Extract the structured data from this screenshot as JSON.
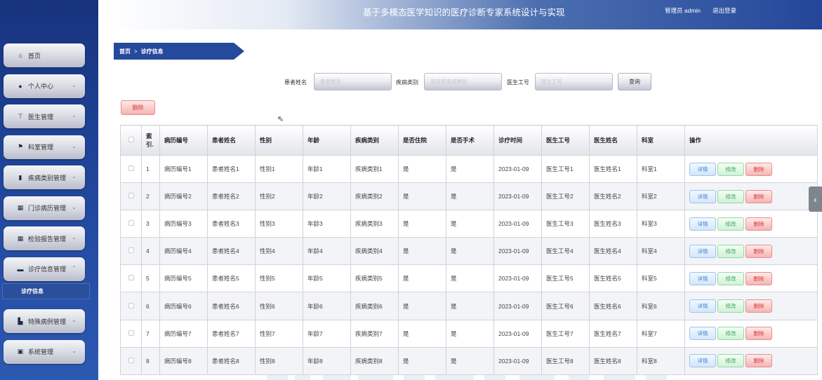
{
  "header": {
    "title": "基于多模态医学知识的医疗诊断专家系统设计与实现",
    "admin": "管理员 admin",
    "logout": "退出登录"
  },
  "sidebar": {
    "items": [
      {
        "label": "首页",
        "icon": "home-icon",
        "glyph": "⌂",
        "chevron": ""
      },
      {
        "label": "个人中心",
        "icon": "user-icon",
        "glyph": "●",
        "chevron": "⌄"
      },
      {
        "label": "医生管理",
        "icon": "doctor-icon",
        "glyph": "⊤",
        "chevron": "⌄"
      },
      {
        "label": "科室管理",
        "icon": "flag-icon",
        "glyph": "⚑",
        "chevron": "⌄"
      },
      {
        "label": "疾病类别管理",
        "icon": "bar-chart-icon",
        "glyph": "▮",
        "chevron": "⌄"
      },
      {
        "label": "门诊病历管理",
        "icon": "grid-icon",
        "glyph": "▦",
        "chevron": "⌄"
      },
      {
        "label": "检验报告管理",
        "icon": "grid-icon",
        "glyph": "▦",
        "chevron": "⌄"
      },
      {
        "label": "诊疗信息管理",
        "icon": "database-icon",
        "glyph": "▬",
        "chevron": "⌃"
      },
      {
        "label": "特殊病例管理",
        "icon": "book-icon",
        "glyph": "▙",
        "chevron": "⌄"
      },
      {
        "label": "系统管理",
        "icon": "settings-square-icon",
        "glyph": "▣",
        "chevron": "⌄"
      }
    ],
    "submenu": "诊疗信息"
  },
  "breadcrumb": {
    "home": "首页",
    "sep": ">",
    "current": "诊疗信息"
  },
  "search": {
    "patient_label": "患者姓名",
    "patient_placeholder": "患者姓名",
    "disease_label": "疾病类别",
    "disease_placeholder": "请选择疾病类别",
    "doctor_label": "医生工号",
    "doctor_placeholder": "医生工号",
    "query": "查询"
  },
  "delete_label": "删除",
  "table": {
    "headers": [
      "索引",
      "病历编号",
      "患者姓名",
      "性别",
      "年龄",
      "疾病类别",
      "是否住院",
      "是否手术",
      "诊疗时间",
      "医生工号",
      "医生姓名",
      "科室",
      "操作"
    ],
    "index_header_lines": [
      "索",
      "引."
    ],
    "rows": [
      [
        "1",
        "病历编号1",
        "患者姓名1",
        "性别1",
        "年龄1",
        "疾病类别1",
        "是",
        "是",
        "2023-01-09",
        "医生工号1",
        "医生姓名1",
        "科室1"
      ],
      [
        "2",
        "病历编号2",
        "患者姓名2",
        "性别2",
        "年龄2",
        "疾病类别2",
        "是",
        "是",
        "2023-01-09",
        "医生工号2",
        "医生姓名2",
        "科室2"
      ],
      [
        "3",
        "病历编号3",
        "患者姓名3",
        "性别3",
        "年龄3",
        "疾病类别3",
        "是",
        "是",
        "2023-01-09",
        "医生工号3",
        "医生姓名3",
        "科室3"
      ],
      [
        "4",
        "病历编号4",
        "患者姓名4",
        "性别4",
        "年龄4",
        "疾病类别4",
        "是",
        "是",
        "2023-01-09",
        "医生工号4",
        "医生姓名4",
        "科室4"
      ],
      [
        "5",
        "病历编号5",
        "患者姓名5",
        "性别5",
        "年龄5",
        "疾病类别5",
        "是",
        "是",
        "2023-01-09",
        "医生工号5",
        "医生姓名5",
        "科室5"
      ],
      [
        "6",
        "病历编号6",
        "患者姓名6",
        "性别6",
        "年龄6",
        "疾病类别6",
        "是",
        "是",
        "2023-01-09",
        "医生工号6",
        "医生姓名6",
        "科室6"
      ],
      [
        "7",
        "病历编号7",
        "患者姓名7",
        "性别7",
        "年龄7",
        "疾病类别7",
        "是",
        "是",
        "2023-01-09",
        "医生工号7",
        "医生姓名7",
        "科室7"
      ],
      [
        "8",
        "病历编号8",
        "患者姓名8",
        "性别8",
        "年龄8",
        "疾病类别8",
        "是",
        "是",
        "2023-01-09",
        "医生工号8",
        "医生姓名8",
        "科室8"
      ]
    ],
    "actions": {
      "detail": "详情",
      "edit": "修改",
      "delete": "删除"
    }
  },
  "colors": {
    "primary": "#254a9d",
    "danger": "#dd3333",
    "success": "#3ea659",
    "info": "#3b82cf"
  }
}
